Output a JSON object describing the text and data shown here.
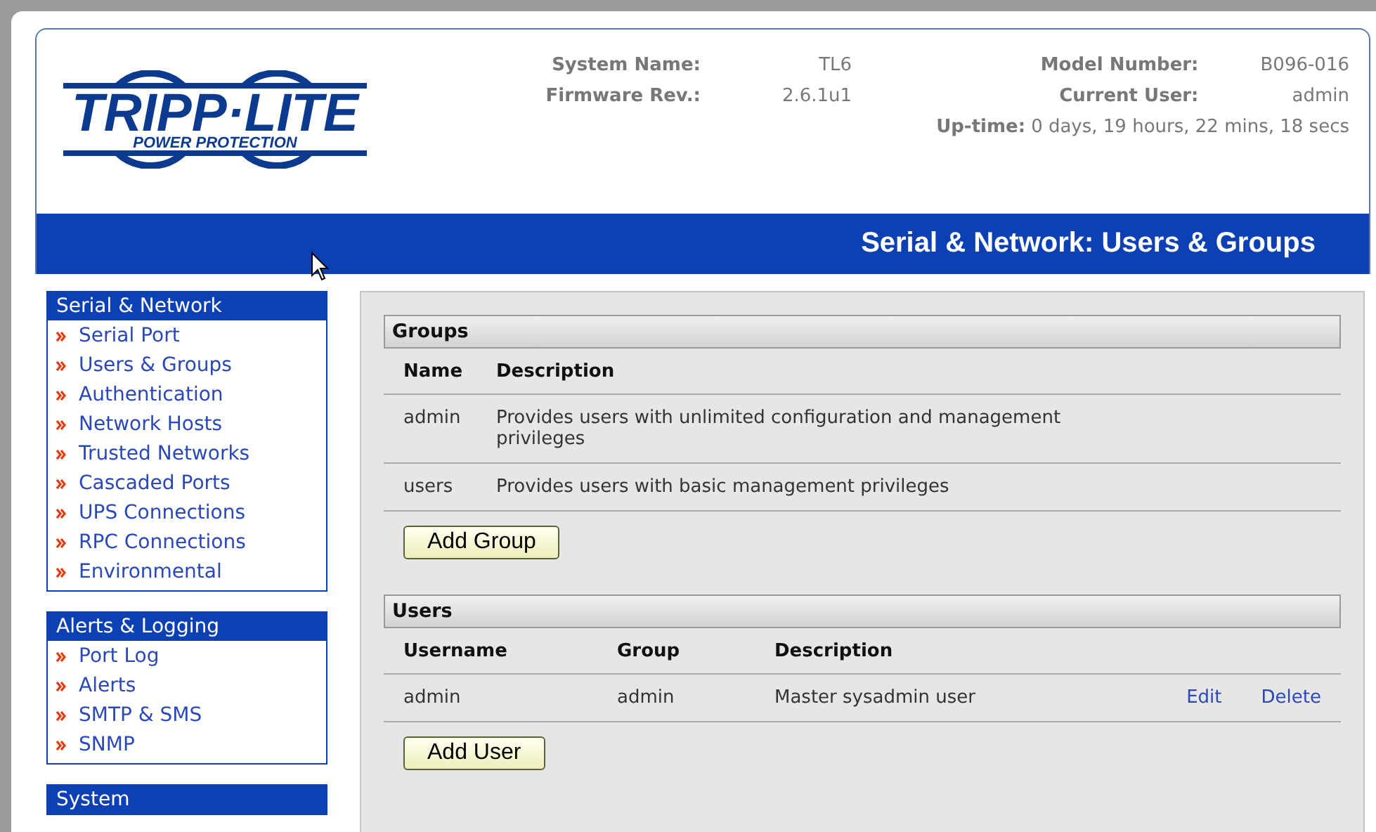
{
  "logo": {
    "name": "TRIPP·LITE",
    "tagline": "POWER PROTECTION"
  },
  "system_info": [
    {
      "label": "System Name:",
      "value": "TL6"
    },
    {
      "label": "Firmware Rev.:",
      "value": "2.6.1u1"
    }
  ],
  "device_info": [
    {
      "label": "Model Number:",
      "value": "B096-016"
    },
    {
      "label": "Current User:",
      "value": "admin"
    }
  ],
  "uptime": {
    "label": "Up-time:",
    "value": "0 days, 19 hours, 22 mins, 18 secs"
  },
  "page_title": "Serial & Network: Users & Groups",
  "sidebar": [
    {
      "title": "Serial & Network",
      "items": [
        "Serial Port",
        "Users & Groups",
        "Authentication",
        "Network Hosts",
        "Trusted Networks",
        "Cascaded Ports",
        "UPS Connections",
        "RPC Connections",
        "Environmental"
      ]
    },
    {
      "title": "Alerts & Logging",
      "items": [
        "Port Log",
        "Alerts",
        "SMTP & SMS",
        "SNMP"
      ]
    },
    {
      "title": "System"
    }
  ],
  "groups": {
    "title": "Groups",
    "columns": [
      "Name",
      "Description"
    ],
    "rows": [
      {
        "name": "admin",
        "description": "Provides users with unlimited configuration and management privileges"
      },
      {
        "name": "users",
        "description": "Provides users with basic management privileges"
      }
    ],
    "button": "Add Group"
  },
  "users": {
    "title": "Users",
    "columns": [
      "Username",
      "Group",
      "Description"
    ],
    "rows": [
      {
        "username": "admin",
        "group": "admin",
        "description": "Master sysadmin user",
        "actions": [
          "Edit",
          "Delete"
        ]
      }
    ],
    "button": "Add User"
  }
}
